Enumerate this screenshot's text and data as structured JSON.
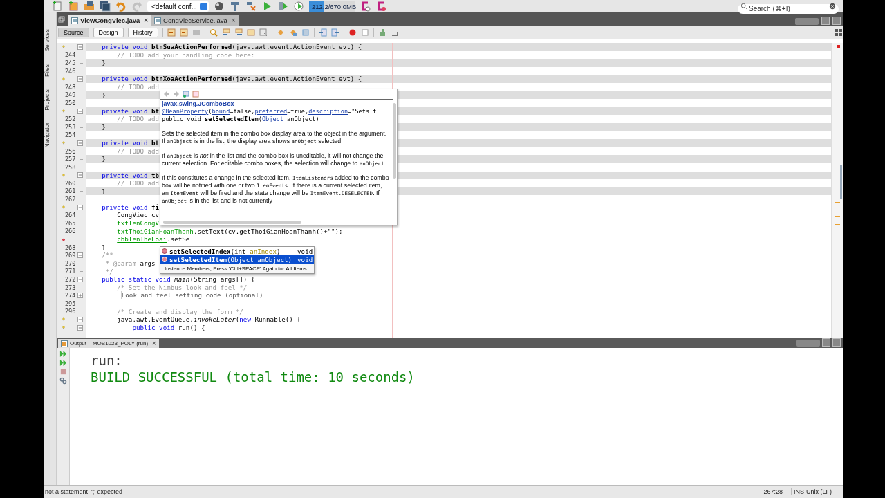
{
  "toolbar": {
    "config_combo": "<default conf...",
    "memory": {
      "text": "212.2/670.0MB",
      "level": 0.32
    },
    "search": {
      "placeholder": "Search (⌘+I)"
    }
  },
  "editor_tabs": [
    {
      "label": "ViewCongViec.java",
      "close": "×",
      "selected": true
    },
    {
      "label": "CongViecService.java",
      "close": "×",
      "selected": false
    }
  ],
  "editor_views": [
    {
      "label": "Source",
      "selected": true
    },
    {
      "label": "Design",
      "selected": false
    },
    {
      "label": "History",
      "selected": false
    }
  ],
  "side_panels": [
    "Services",
    "Files",
    "Projects",
    "Navigator"
  ],
  "code_lines": [
    {
      "hint": true,
      "error": false,
      "fold_start": true,
      "fold_end": false,
      "collapsed": false,
      "guarded": true,
      "segments": [
        {
          "text": "    private void ",
          "kind": "keyword"
        },
        {
          "text": "btnSuaActionPerformed",
          "kind": "bold"
        },
        {
          "text": "(java.awt.event.ActionEvent evt) {",
          "kind": "plain"
        }
      ]
    },
    {
      "number": "244",
      "hint": false,
      "error": false,
      "fold_start": false,
      "fold_end": false,
      "collapsed": false,
      "guarded": false,
      "segments": [
        {
          "text": "        // TODO add your handling code here:",
          "kind": "comment"
        }
      ]
    },
    {
      "number": "245",
      "hint": false,
      "error": false,
      "fold_start": false,
      "fold_end": true,
      "collapsed": false,
      "guarded": true,
      "segments": [
        {
          "text": "    }",
          "kind": "plain"
        }
      ]
    },
    {
      "number": "246",
      "hint": false,
      "error": false,
      "fold_start": false,
      "fold_end": false,
      "collapsed": false,
      "guarded": false
    },
    {
      "hint": true,
      "error": false,
      "fold_start": true,
      "fold_end": false,
      "collapsed": false,
      "guarded": true,
      "segments": [
        {
          "text": "    private void ",
          "kind": "keyword"
        },
        {
          "text": "btnXoaActionPerformed",
          "kind": "bold"
        },
        {
          "text": "(java.awt.event.ActionEvent evt) {",
          "kind": "plain"
        }
      ]
    },
    {
      "number": "248",
      "hint": false,
      "error": false,
      "fold_start": false,
      "fold_end": false,
      "collapsed": false,
      "guarded": false,
      "segments": [
        {
          "text": "        // TODO add ",
          "kind": "comment"
        }
      ]
    },
    {
      "number": "249",
      "hint": false,
      "error": false,
      "fold_start": false,
      "fold_end": true,
      "collapsed": false,
      "guarded": true,
      "segments": [
        {
          "text": "    }",
          "kind": "plain"
        }
      ]
    },
    {
      "number": "250",
      "hint": false,
      "error": false,
      "fold_start": false,
      "fold_end": false,
      "collapsed": false,
      "guarded": false
    },
    {
      "hint": true,
      "error": false,
      "fold_start": true,
      "fold_end": false,
      "collapsed": false,
      "guarded": true,
      "segments": [
        {
          "text": "    private void ",
          "kind": "keyword"
        },
        {
          "text": "bt",
          "kind": "bold"
        }
      ]
    },
    {
      "number": "252",
      "hint": false,
      "error": false,
      "fold_start": false,
      "fold_end": false,
      "collapsed": false,
      "guarded": false,
      "segments": [
        {
          "text": "        // TODO add",
          "kind": "comment"
        }
      ]
    },
    {
      "number": "253",
      "hint": false,
      "error": false,
      "fold_start": false,
      "fold_end": true,
      "collapsed": false,
      "guarded": true,
      "segments": [
        {
          "text": "    }",
          "kind": "plain"
        }
      ]
    },
    {
      "number": "254",
      "hint": false,
      "error": false,
      "fold_start": false,
      "fold_end": false,
      "collapsed": false,
      "guarded": false
    },
    {
      "hint": true,
      "error": false,
      "fold_start": true,
      "fold_end": false,
      "collapsed": false,
      "guarded": true,
      "segments": [
        {
          "text": "    private void ",
          "kind": "keyword"
        },
        {
          "text": "bt",
          "kind": "bold"
        }
      ]
    },
    {
      "number": "256",
      "hint": false,
      "error": false,
      "fold_start": false,
      "fold_end": false,
      "collapsed": false,
      "guarded": false,
      "segments": [
        {
          "text": "        // TODO add",
          "kind": "comment"
        }
      ]
    },
    {
      "number": "257",
      "hint": false,
      "error": false,
      "fold_start": false,
      "fold_end": true,
      "collapsed": false,
      "guarded": true,
      "segments": [
        {
          "text": "    }",
          "kind": "plain"
        }
      ]
    },
    {
      "number": "258",
      "hint": false,
      "error": false,
      "fold_start": false,
      "fold_end": false,
      "collapsed": false,
      "guarded": false
    },
    {
      "hint": true,
      "error": false,
      "fold_start": true,
      "fold_end": false,
      "collapsed": false,
      "guarded": true,
      "segments": [
        {
          "text": "    private void ",
          "kind": "keyword"
        },
        {
          "text": "tb",
          "kind": "bold"
        }
      ]
    },
    {
      "number": "260",
      "hint": false,
      "error": false,
      "fold_start": false,
      "fold_end": false,
      "collapsed": false,
      "guarded": false,
      "segments": [
        {
          "text": "        // TODO add",
          "kind": "comment"
        }
      ]
    },
    {
      "number": "261",
      "hint": false,
      "error": false,
      "fold_start": false,
      "fold_end": true,
      "collapsed": false,
      "guarded": true,
      "segments": [
        {
          "text": "    }",
          "kind": "plain"
        }
      ]
    },
    {
      "number": "262",
      "hint": false,
      "error": false,
      "fold_start": false,
      "fold_end": false,
      "collapsed": false,
      "guarded": false
    },
    {
      "hint": true,
      "error": false,
      "fold_start": true,
      "fold_end": false,
      "collapsed": false,
      "guarded": false,
      "segments": [
        {
          "text": "    private void ",
          "kind": "keyword"
        },
        {
          "text": "fi",
          "kind": "bold"
        }
      ]
    },
    {
      "number": "264",
      "hint": false,
      "error": false,
      "fold_start": false,
      "fold_end": false,
      "collapsed": false,
      "guarded": false,
      "segments": [
        {
          "text": "        CongViec cv",
          "kind": "plain"
        }
      ]
    },
    {
      "number": "265",
      "hint": false,
      "error": false,
      "fold_start": false,
      "fold_end": false,
      "collapsed": false,
      "guarded": false,
      "segments": [
        {
          "text": "        txtTenCongV",
          "kind": "field"
        }
      ]
    },
    {
      "number": "266",
      "hint": false,
      "error": false,
      "fold_start": false,
      "fold_end": false,
      "collapsed": false,
      "guarded": false,
      "segments": [
        {
          "text": "        txtThoiGianHoanThanh",
          "kind": "field"
        },
        {
          "text": ".setText(cv.getThoiGianHoanThanh()+\"\");",
          "kind": "plain"
        }
      ]
    },
    {
      "hint": false,
      "error": true,
      "fold_start": false,
      "fold_end": false,
      "collapsed": false,
      "guarded": false,
      "segments": [
        {
          "text": "        cbbTenTheLoai",
          "kind": "error-field"
        },
        {
          "text": ".",
          "kind": "plain"
        },
        {
          "text": "setSe",
          "kind": "typed"
        }
      ]
    },
    {
      "number": "268",
      "hint": false,
      "error": false,
      "fold_start": false,
      "fold_end": true,
      "collapsed": false,
      "guarded": false,
      "segments": [
        {
          "text": "    }",
          "kind": "plain"
        }
      ]
    },
    {
      "number": "269",
      "hint": false,
      "error": false,
      "fold_start": true,
      "fold_end": false,
      "collapsed": false,
      "guarded": false,
      "segments": [
        {
          "text": "    /**",
          "kind": "comment"
        }
      ]
    },
    {
      "number": "270",
      "hint": false,
      "error": false,
      "fold_start": false,
      "fold_end": false,
      "collapsed": false,
      "guarded": false,
      "segments": [
        {
          "text": "     * @param",
          "kind": "comment"
        },
        {
          "text": " args",
          "kind": "plain"
        }
      ]
    },
    {
      "number": "271",
      "hint": false,
      "error": false,
      "fold_start": false,
      "fold_end": true,
      "collapsed": false,
      "guarded": false,
      "segments": [
        {
          "text": "     */",
          "kind": "comment"
        }
      ]
    },
    {
      "number": "272",
      "hint": false,
      "error": false,
      "fold_start": true,
      "fold_end": false,
      "collapsed": false,
      "guarded": false,
      "segments": [
        {
          "text": "    public static void ",
          "kind": "keyword"
        },
        {
          "text": "main",
          "kind": "italic"
        },
        {
          "text": "(String args[]) {",
          "kind": "plain"
        }
      ]
    },
    {
      "number": "273",
      "hint": false,
      "error": false,
      "fold_start": false,
      "fold_end": false,
      "collapsed": false,
      "guarded": false,
      "segments": [
        {
          "text": "        /* Set the Nimbus look and feel */",
          "kind": "comment"
        }
      ]
    },
    {
      "number": "274",
      "hint": false,
      "error": false,
      "fold_start": false,
      "fold_end": false,
      "collapsed": true,
      "guarded": false,
      "segments": [
        {
          "text": "         Look and feel setting code (optional)",
          "kind": "folded"
        }
      ]
    },
    {
      "number": "295",
      "hint": false,
      "error": false,
      "fold_start": false,
      "fold_end": false,
      "collapsed": false,
      "guarded": false
    },
    {
      "number": "296",
      "hint": false,
      "error": false,
      "fold_start": false,
      "fold_end": false,
      "collapsed": false,
      "guarded": false,
      "segments": [
        {
          "text": "        /* Create and display the form */",
          "kind": "comment"
        }
      ]
    },
    {
      "hint": true,
      "error": false,
      "fold_start": true,
      "fold_end": false,
      "collapsed": false,
      "guarded": false,
      "segments": [
        {
          "text": "        java.awt.EventQueue.",
          "kind": "plain"
        },
        {
          "text": "invokeLater",
          "kind": "italic"
        },
        {
          "text": "(",
          "kind": "plain"
        },
        {
          "text": "new",
          "kind": "keyword"
        },
        {
          "text": " Runnable() {",
          "kind": "plain"
        }
      ]
    },
    {
      "hint": true,
      "error": false,
      "fold_start": true,
      "fold_end": false,
      "collapsed": false,
      "guarded": false,
      "segments": [
        {
          "text": "            public void ",
          "kind": "keyword"
        },
        {
          "text": "run() {",
          "kind": "plain"
        }
      ]
    }
  ],
  "javadoc": {
    "class_link": "javax.swing.JComboBox",
    "annotation": [
      {
        "text": "@BeanProperty",
        "kind": "link"
      },
      {
        "text": "(",
        "kind": "plain"
      },
      {
        "text": "bound",
        "kind": "link"
      },
      {
        "text": "=false,",
        "kind": "plain"
      },
      {
        "text": "preferred",
        "kind": "link"
      },
      {
        "text": "=true,",
        "kind": "plain"
      },
      {
        "text": "description",
        "kind": "link"
      },
      {
        "text": "=\"Sets t",
        "kind": "plain"
      }
    ],
    "signature": [
      {
        "text": "public void ",
        "kind": "plain"
      },
      {
        "text": "setSelectedItem",
        "kind": "bold"
      },
      {
        "text": "(",
        "kind": "plain"
      },
      {
        "text": "Object",
        "kind": "link"
      },
      {
        "text": " anObject)",
        "kind": "plain"
      }
    ],
    "paragraphs": [
      [
        {
          "text": "Sets the selected item in the combo box display area to the object in the argument. If ",
          "kind": "text"
        },
        {
          "text": "anObject",
          "kind": "code"
        },
        {
          "text": " is in the list, the display area shows ",
          "kind": "text"
        },
        {
          "text": "anObject",
          "kind": "code"
        },
        {
          "text": " selected.",
          "kind": "text"
        }
      ],
      [
        {
          "text": "If ",
          "kind": "text"
        },
        {
          "text": "anObject",
          "kind": "code"
        },
        {
          "text": " is ",
          "kind": "text"
        },
        {
          "text": "not",
          "kind": "italic"
        },
        {
          "text": " in the list and the combo box is uneditable, it will not change the current selection. For editable combo boxes, the selection will change to ",
          "kind": "text"
        },
        {
          "text": "anObject",
          "kind": "code"
        },
        {
          "text": ".",
          "kind": "text"
        }
      ],
      [
        {
          "text": "If this constitutes a change in the selected item, ",
          "kind": "text"
        },
        {
          "text": "ItemListeners",
          "kind": "code"
        },
        {
          "text": " added to the combo box will be notified with one or two ",
          "kind": "text"
        },
        {
          "text": "ItemEvents",
          "kind": "code"
        },
        {
          "text": ". If there is a current selected item, an ",
          "kind": "text"
        },
        {
          "text": "ItemEvent",
          "kind": "code"
        },
        {
          "text": " will be fired and the state change will be ",
          "kind": "text"
        },
        {
          "text": "ItemEvent.DESELECTED",
          "kind": "code"
        },
        {
          "text": ". If ",
          "kind": "text"
        },
        {
          "text": "anObject",
          "kind": "code"
        },
        {
          "text": " is in the list and is not currently",
          "kind": "text"
        }
      ]
    ]
  },
  "completion": {
    "items": [
      {
        "name": "setSelectedIndex",
        "params": [
          {
            "text": "(int ",
            "kind": "plain"
          },
          {
            "text": "anIndex",
            "kind": "param"
          },
          {
            "text": ")",
            "kind": "plain"
          }
        ],
        "type": "void",
        "selected": false
      },
      {
        "name": "setSelectedItem",
        "params": [
          {
            "text": "(Object ",
            "kind": "plain"
          },
          {
            "text": "anObject",
            "kind": "param"
          },
          {
            "text": ")",
            "kind": "plain"
          }
        ],
        "type": "void",
        "selected": true
      }
    ],
    "footer": "Instance Members; Press 'Ctrl+SPACE' Again for All Items"
  },
  "output": {
    "tab": "Output – MOB1023_POLY (run)",
    "close": "×",
    "lines": [
      {
        "text": "run:",
        "kind": "info"
      },
      {
        "text": "BUILD SUCCESSFUL (total time: 10 seconds)",
        "kind": "success"
      }
    ]
  },
  "status_bar": {
    "message": "not a statement  ';' expected",
    "position": "267:28",
    "mode": "INS",
    "line_ending": "Unix (LF)"
  }
}
